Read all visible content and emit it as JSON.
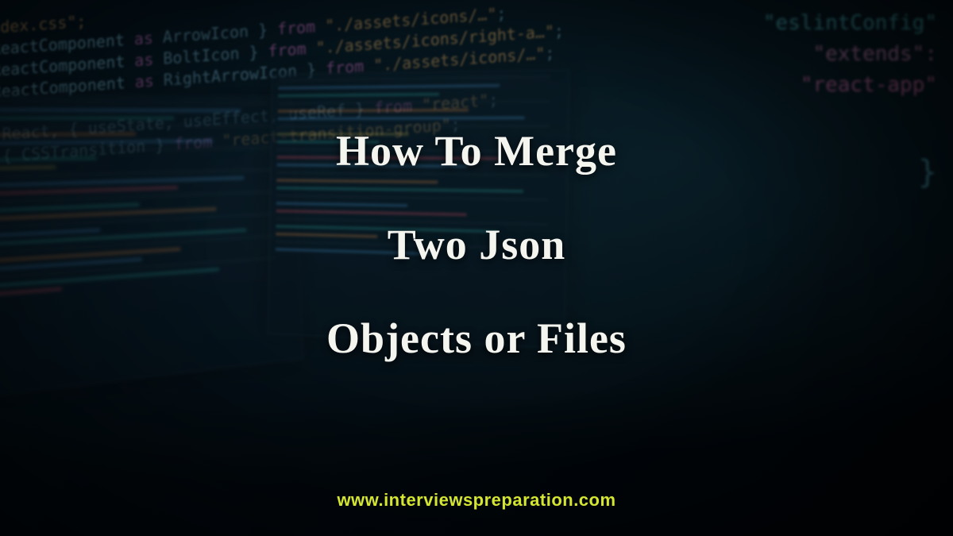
{
  "title": {
    "line1": "How To Merge",
    "line2": "Two Json",
    "line3": "Objects or Files"
  },
  "watermark": "www.interviewspreparation.com",
  "bg_code": {
    "left_lines": [
      "../Index.css\";",
      "t { ReactComponent as ArrowIcon } from \"./assets/icons/…",
      "t { ReactComponent as BoltIcon } from \"./assets/icons/right-a…",
      "t { ReactComponent as RightArrowIcon } from \"./assets/icons/…",
      "",
      "port React, { useState, useEffect, useRef } from \"react\";",
      "port { CSSTransition } from \"react-transition-group\";"
    ],
    "right_lines": [
      "\"eslintConfig\"",
      "\"extends\":",
      "\"react-app\""
    ]
  }
}
